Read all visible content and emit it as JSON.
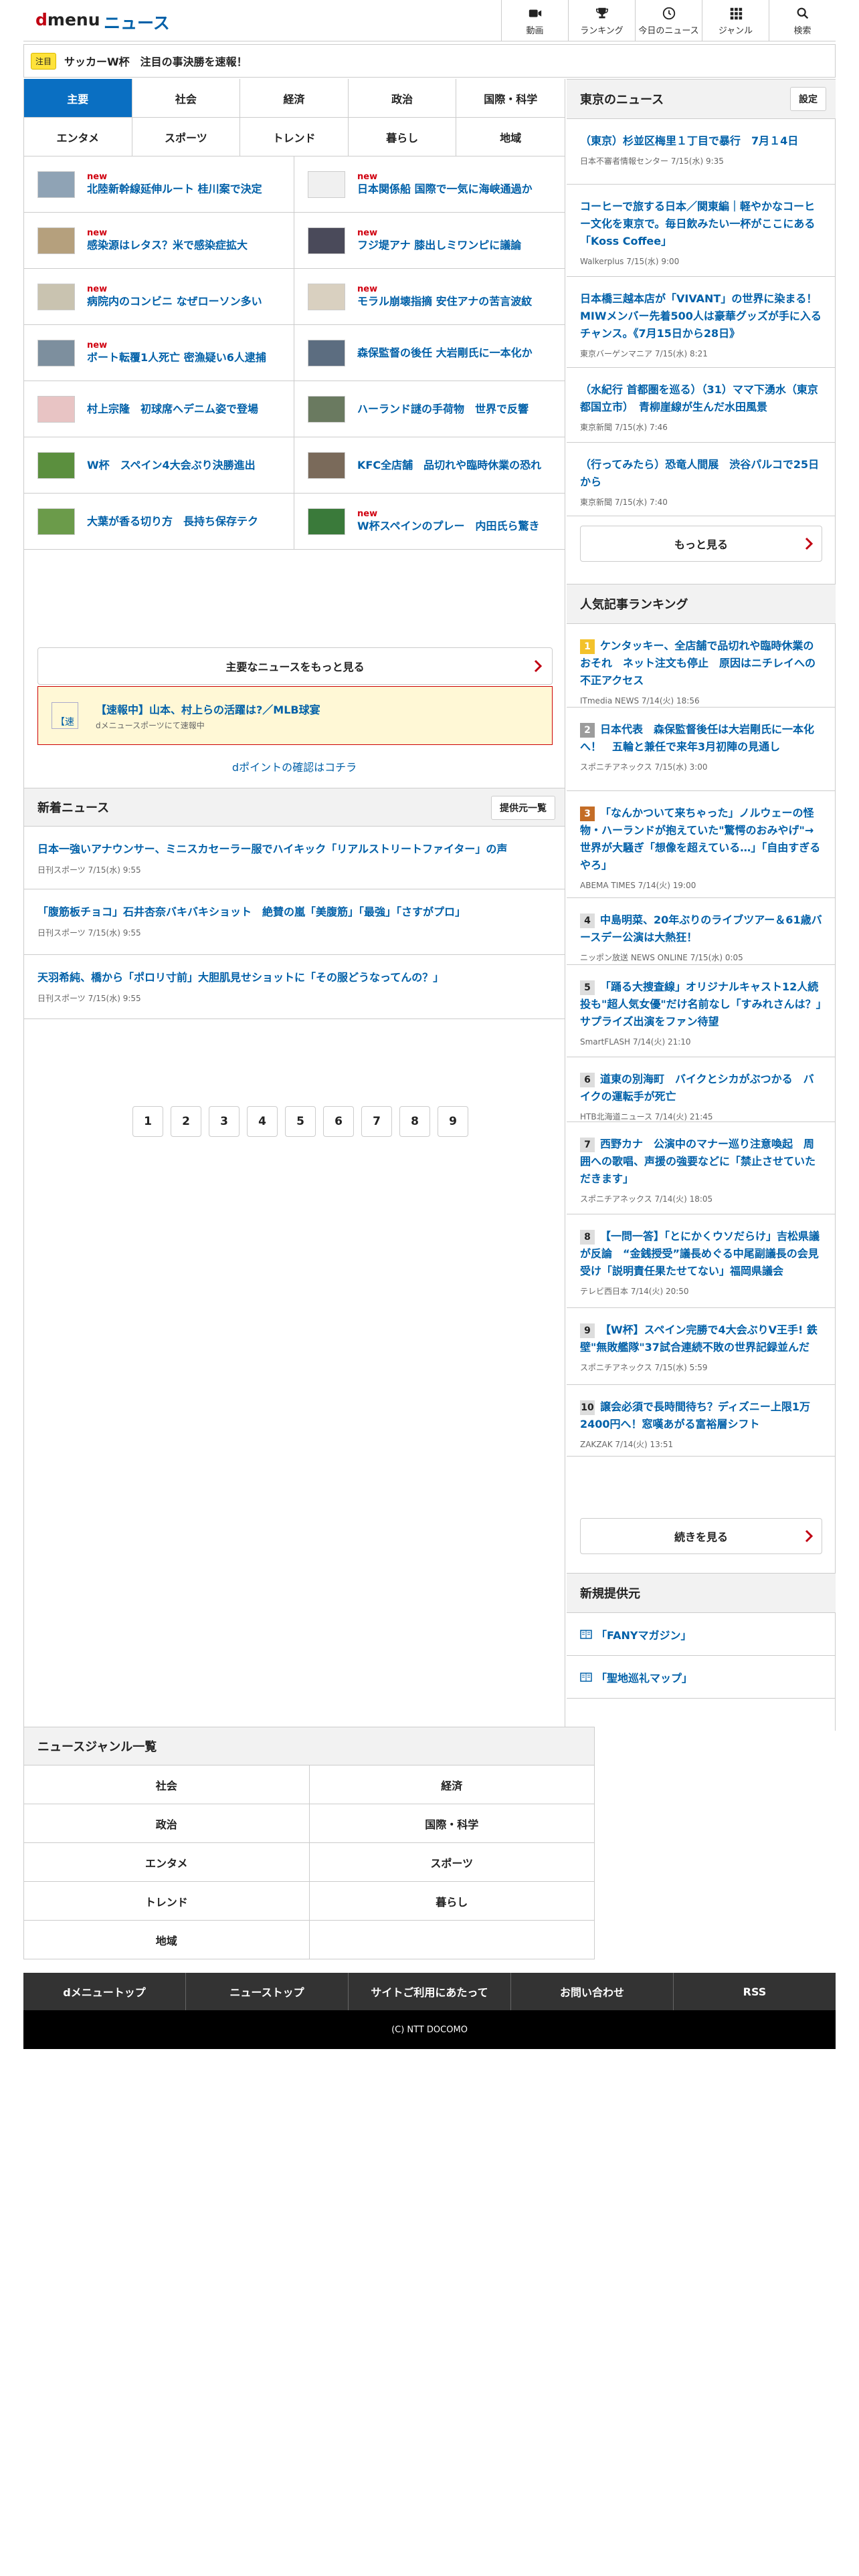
{
  "header": {
    "logo_d": "d",
    "logo_menu": "menu",
    "brand": "ニュース",
    "nav": [
      {
        "label": "動画",
        "icon": "video-icon"
      },
      {
        "label": "ランキング",
        "icon": "trophy-icon"
      },
      {
        "label": "今日のニュース",
        "icon": "clock-icon"
      },
      {
        "label": "ジャンル",
        "icon": "grid-icon"
      },
      {
        "label": "検索",
        "icon": "search-icon"
      }
    ]
  },
  "notice": {
    "badge": "注目",
    "text": "サッカーW杯　注目の事決勝を速報！"
  },
  "tabs": [
    "主要",
    "社会",
    "経済",
    "政治",
    "国際・科学",
    "エンタメ",
    "スポーツ",
    "トレンド",
    "暮らし",
    "地域"
  ],
  "top_news": [
    {
      "title": "北陸新幹線延伸ルート 桂川案で決定",
      "new": "new"
    },
    {
      "title": "日本関係船 国際で一気に海峡通過か",
      "new": "new"
    },
    {
      "title": "感染源はレタス？米で感染症拡大",
      "new": "new"
    },
    {
      "title": "フジ堤アナ 膝出しミワンピに議論",
      "new": "new"
    },
    {
      "title": "病院内のコンビニ なぜローソン多い",
      "new": "new"
    },
    {
      "title": "モラル崩壊指摘 安住アナの苦言波紋",
      "new": "new"
    },
    {
      "title": "ボート転覆1人死亡 密漁疑い6人逮捕",
      "new": "new"
    },
    {
      "title": "森保監督の後任 大岩剛氏に一本化か",
      "new": ""
    },
    {
      "title": "村上宗隆　初球席へデニム姿で登場",
      "new": ""
    },
    {
      "title": "ハーランド謎の手荷物　世界で反響",
      "new": ""
    },
    {
      "title": "W杯　スペイン4大会ぶり決勝進出",
      "new": ""
    },
    {
      "title": "KFC全店舗　品切れや臨時休業の恐れ",
      "new": ""
    },
    {
      "title": "大葉が香る切り方　長持ち保存テク",
      "new": ""
    },
    {
      "title": "W杯スペインのプレー　内田氏ら驚き",
      "new": "new"
    }
  ],
  "more_main": "主要なニュースをもっと見る",
  "banner": {
    "img_alt": "【速",
    "title": "【速報中】山本、村上らの活躍は?／MLB球宴",
    "sub": "dメニュースポーツにて速報中"
  },
  "dpoint": "dポイントの確認はコチラ",
  "latest": {
    "title": "新着ニュース",
    "button": "提供元一覧",
    "items": [
      {
        "title": "日本一強いアナウンサー、ミニスカセーラー服でハイキック「リアルストリートファイター」の声",
        "meta": "日刊スポーツ 7/15(水) 9:55"
      },
      {
        "title": "「腹筋板チョコ」石井杏奈バキバキショット　絶賛の嵐「美腹筋」「最強」「さすがプロ」",
        "meta": "日刊スポーツ 7/15(水) 9:55"
      },
      {
        "title": "天羽希純、橋から「ポロリ寸前」大胆肌見せショットに「その服どうなってんの？」",
        "meta": "日刊スポーツ 7/15(水) 9:55"
      }
    ]
  },
  "pager": [
    "1",
    "2",
    "3",
    "4",
    "5",
    "6",
    "7",
    "8",
    "9"
  ],
  "tokyo": {
    "title": "東京のニュース",
    "button": "設定",
    "items": [
      {
        "title": "（東京）杉並区梅里１丁目で暴行　7月１4日",
        "meta": "日本不審者情報センター 7/15(水) 9:35"
      },
      {
        "title": "コーヒーで旅する日本／関東編｜軽やかなコーヒー文化を東京で。毎日飲みたい一杯がここにある「Koss Coffee」",
        "meta": "Walkerplus 7/15(水) 9:00"
      },
      {
        "title": "日本橋三越本店が「VIVANT」の世界に染まる！MIWメンバー先着500人は豪華グッズが手に入るチャンス。《7月15日から28日》",
        "meta": "東京バーゲンマニア 7/15(水) 8:21"
      },
      {
        "title": "（水紀行 首都圏を巡る）（31）ママ下湧水（東京都国立市）　青柳崖線が生んだ水田風景",
        "meta": "東京新聞 7/15(水) 7:46"
      },
      {
        "title": "（行ってみたら）恐竜人間展　渋谷パルコで25日から",
        "meta": "東京新聞 7/15(水) 7:40"
      }
    ],
    "more": "もっと見る"
  },
  "ranking": {
    "title": "人気記事ランキング",
    "items": [
      {
        "rank": "1",
        "title": "ケンタッキー、全店舗で品切れや臨時休業のおそれ　ネット注文も停止　原因はニチレイへの不正アクセス",
        "meta": "ITmedia NEWS 7/14(火) 18:56"
      },
      {
        "rank": "2",
        "title": "日本代表　森保監督後任は大岩剛氏に一本化へ！　五輪と兼任で来年3月初陣の見通し",
        "meta": "スポニチアネックス 7/15(水) 3:00"
      },
      {
        "rank": "3",
        "title": "「なんかついて来ちゃった」ノルウェーの怪物・ハーランドが抱えていた\"驚愕のおみやげ\"→世界が大騒ぎ「想像を超えている…」「自由すぎるやろ」",
        "meta": "ABEMA TIMES 7/14(火) 19:00"
      },
      {
        "rank": "4",
        "title": "中島明菜、20年ぶりのライブツアー＆61歳バースデー公演は大熱狂！",
        "meta": "ニッポン放送 NEWS ONLINE 7/15(水) 0:05"
      },
      {
        "rank": "5",
        "title": "「踊る大捜査線」オリジナルキャスト12人続投も\"超人気女優\"だけ名前なし「すみれさんは？」サプライズ出演をファン待望",
        "meta": "SmartFLASH 7/14(火) 21:10"
      },
      {
        "rank": "6",
        "title": "道東の別海町　バイクとシカがぶつかる　バイクの運転手が死亡",
        "meta": "HTB北海道ニュース 7/14(火) 21:45"
      },
      {
        "rank": "7",
        "title": "西野カナ　公演中のマナー巡り注意喚起　周囲への歌唱、声援の強要などに「禁止させていただきます」",
        "meta": "スポニチアネックス 7/14(火) 18:05"
      },
      {
        "rank": "8",
        "title": "【一問一答】「とにかくウソだらけ」吉松県議が反論　“金銭授受”議長めぐる中尾副議長の会見受け「説明責任果たせてない」福岡県議会",
        "meta": "テレビ西日本 7/14(火) 20:50"
      },
      {
        "rank": "9",
        "title": "【W杯】スペイン完勝で4大会ぶりV王手! 鉄壁\"無敗艦隊\"37試合連続不敗の世界記録並んだ",
        "meta": "スポニチアネックス 7/15(水) 5:59"
      },
      {
        "rank": "10",
        "title": "譲会必須で長時間待ち？ディズニー上限1万2400円へ！窓嘆あがる富裕層シフト",
        "meta": "ZAKZAK 7/14(火) 13:51"
      }
    ],
    "more": "続きを見る"
  },
  "providers": {
    "title": "新規提供元",
    "items": [
      "「FANYマガジン」",
      "「聖地巡礼マップ」"
    ]
  },
  "genre": {
    "title": "ニュースジャンル一覧",
    "items": [
      "社会",
      "経済",
      "政治",
      "国際・科学",
      "エンタメ",
      "スポーツ",
      "トレンド",
      "暮らし",
      "地域",
      ""
    ]
  },
  "footer": {
    "links": [
      "dメニュートップ",
      "ニューストップ",
      "サイトご利用にあたって",
      "お問い合わせ",
      "RSS"
    ],
    "copyright": "(C) NTT DOCOMO"
  },
  "colors": {
    "accent": "#0a6fc2",
    "link": "#0060a8",
    "brand_red": "#c00011",
    "new_red": "#d00010",
    "notice_yellow": "#ffe23a"
  }
}
